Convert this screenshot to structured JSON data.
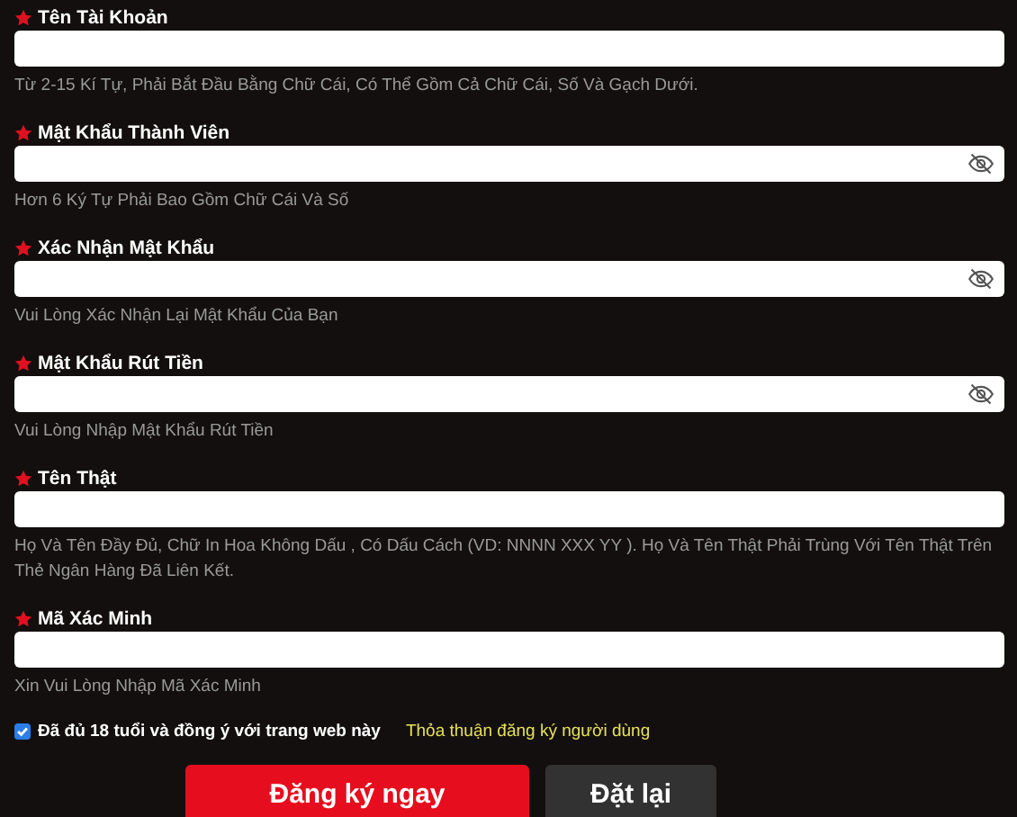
{
  "fields": [
    {
      "label": "Tên Tài Khoản",
      "kind": "text",
      "hint": "Từ 2-15 Kí Tự, Phải Bắt Đầu Bằng Chữ Cái, Có Thể Gồm Cả Chữ Cái, Số Và Gạch Dưới."
    },
    {
      "label": "Mật Khẩu Thành Viên",
      "kind": "password",
      "hint": "Hơn 6 Ký Tự Phải Bao Gồm Chữ Cái Và Số"
    },
    {
      "label": "Xác Nhận Mật Khẩu",
      "kind": "password",
      "hint": "Vui Lòng Xác Nhận Lại Mật Khẩu Của Bạn"
    },
    {
      "label": "Mật Khẩu Rút Tiền",
      "kind": "password",
      "hint": "Vui Lòng Nhập Mật Khẩu Rút Tiền"
    },
    {
      "label": "Tên Thật",
      "kind": "text",
      "hint": "Họ Và Tên Đầy Đủ, Chữ In Hoa Không Dấu , Có Dấu Cách (VD: NNNN XXX YY ). Họ Và Tên Thật Phải Trùng Với Tên Thật Trên Thẻ Ngân Hàng Đã Liên Kết."
    },
    {
      "label": "Mã Xác Minh",
      "kind": "text",
      "hint": "Xin Vui Lòng Nhập Mã Xác Minh"
    }
  ],
  "agreement": {
    "checked": true,
    "label": "Đã đủ 18 tuổi và đồng ý với trang web này",
    "link": "Thỏa thuận đăng ký người dùng"
  },
  "buttons": [
    {
      "label": "Đăng ký ngay",
      "kind": "primary"
    },
    {
      "label": "Đặt lại",
      "kind": "secondary"
    }
  ]
}
